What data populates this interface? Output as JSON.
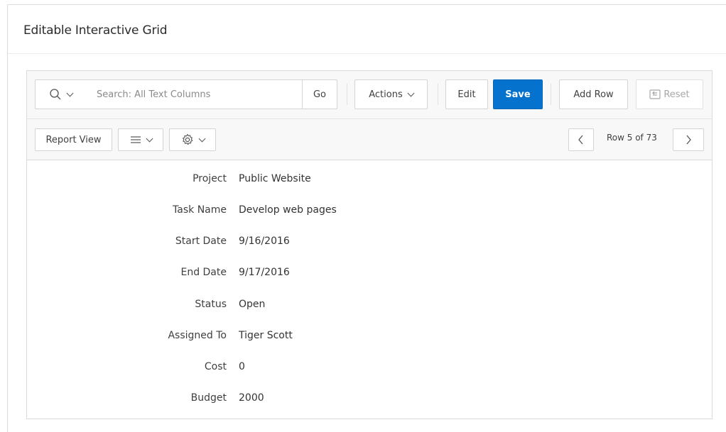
{
  "region": {
    "title": "Editable Interactive Grid"
  },
  "toolbar": {
    "search_placeholder": "Search: All Text Columns",
    "go_label": "Go",
    "actions_label": "Actions",
    "edit_label": "Edit",
    "save_label": "Save",
    "add_row_label": "Add Row",
    "reset_label": "Reset"
  },
  "toolbar2": {
    "report_view_label": "Report View",
    "row_info": "Row 5 of 73"
  },
  "record": {
    "fields": [
      {
        "label": "Project",
        "value": "Public Website"
      },
      {
        "label": "Task Name",
        "value": "Develop web pages"
      },
      {
        "label": "Start Date",
        "value": "9/16/2016"
      },
      {
        "label": "End Date",
        "value": "9/17/2016"
      },
      {
        "label": "Status",
        "value": "Open"
      },
      {
        "label": "Assigned To",
        "value": "Tiger Scott"
      },
      {
        "label": "Cost",
        "value": "0"
      },
      {
        "label": "Budget",
        "value": "2000"
      }
    ]
  },
  "colors": {
    "primary": "#0572ce",
    "toolbar_bg": "#f8f8f8",
    "border": "#dadada"
  },
  "icons": [
    "search-icon",
    "menu-lines-icon",
    "gear-icon",
    "reset-icon",
    "chevron-left-icon",
    "chevron-right-icon"
  ]
}
